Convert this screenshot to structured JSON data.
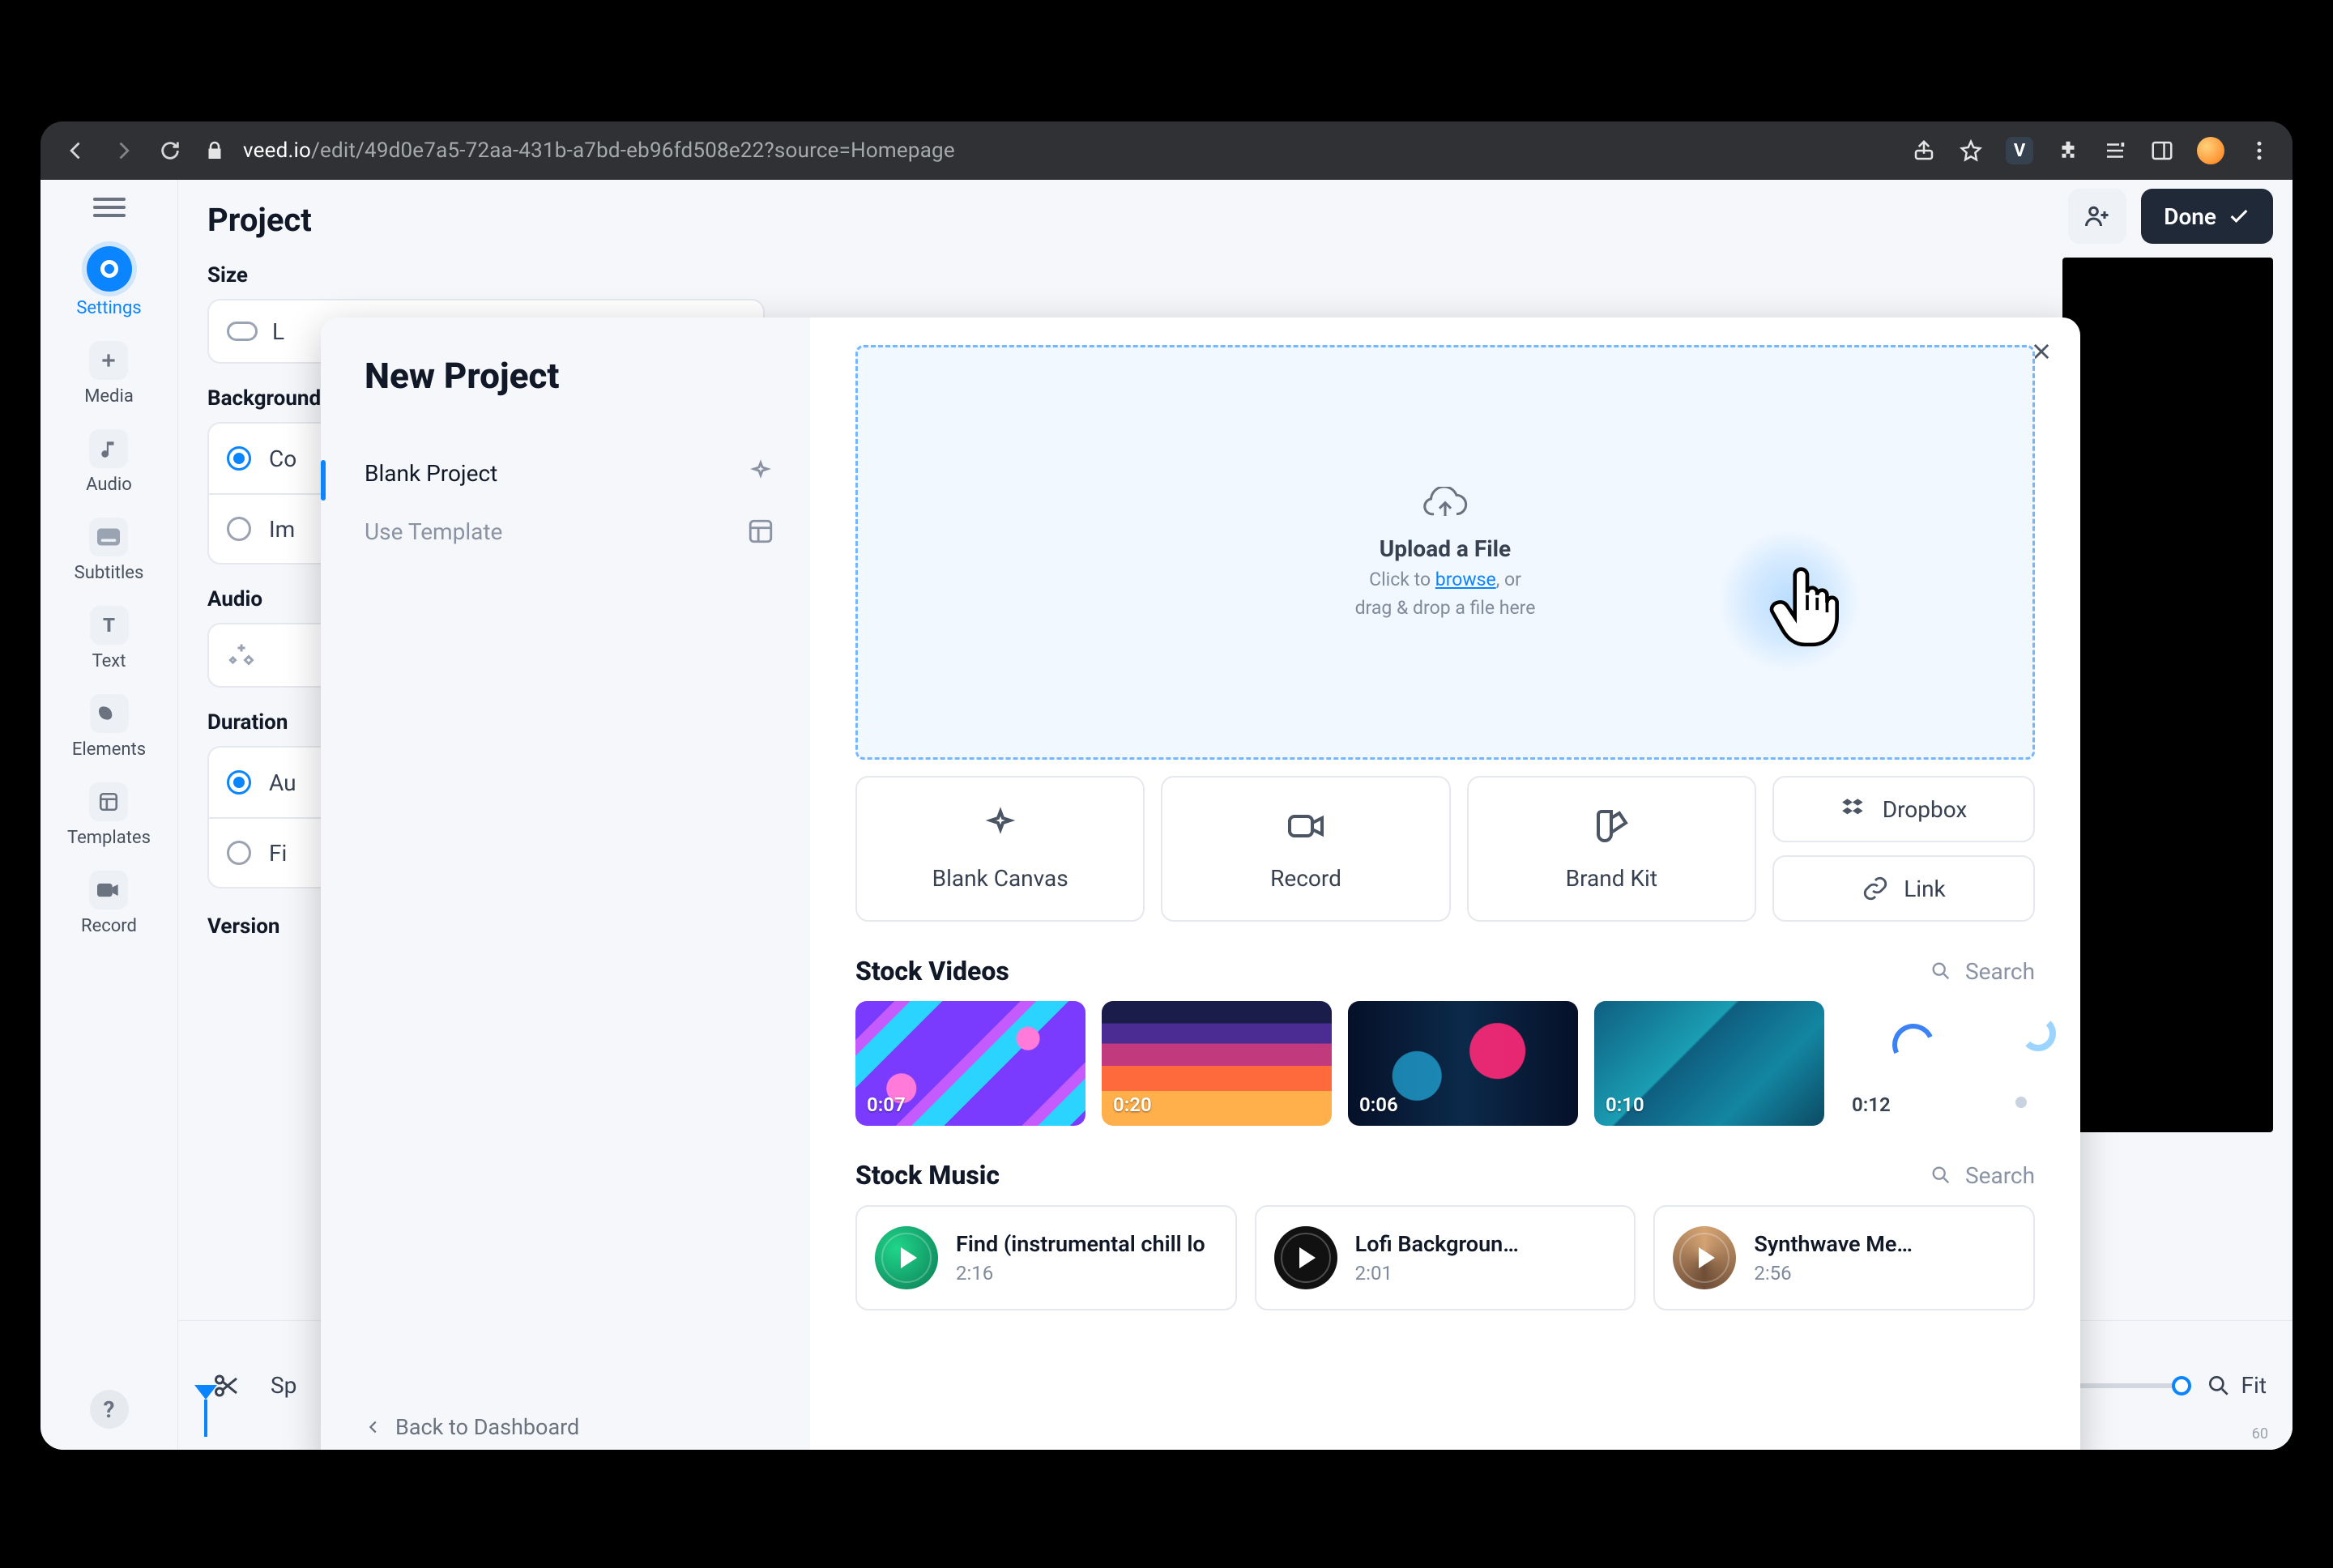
{
  "chrome": {
    "host": "veed.io",
    "path": "/edit/49d0e7a5-72aa-431b-a7bd-eb96fd508e22?source=Homepage",
    "ext_letter": "V"
  },
  "top": {
    "done": "Done"
  },
  "rail": {
    "settings": "Settings",
    "media": "Media",
    "audio": "Audio",
    "subtitles": "Subtitles",
    "text": "Text",
    "elements": "Elements",
    "templates": "Templates",
    "record": "Record",
    "help": "?"
  },
  "settings": {
    "title": "Project",
    "size_label": "Size",
    "size_value": "L",
    "background_label": "Background",
    "bg_color": "Co",
    "bg_image": "Im",
    "audio_label": "Audio",
    "duration_label": "Duration",
    "dur_auto": "Au",
    "dur_fixed": "Fi",
    "version_label": "Version",
    "split": "Sp"
  },
  "bottombar": {
    "fit": "Fit",
    "timeline_end": "60"
  },
  "modal": {
    "title": "New Project",
    "blank": "Blank Project",
    "template": "Use Template",
    "back": "Back to Dashboard",
    "upload_title": "Upload a File",
    "upload_sub_pre": "Click to ",
    "upload_browse": "browse",
    "upload_sub_post": ", or",
    "upload_sub2": "drag & drop a file here",
    "blank_canvas": "Blank Canvas",
    "record": "Record",
    "brand_kit": "Brand Kit",
    "dropbox": "Dropbox",
    "link": "Link",
    "stock_videos": "Stock Videos",
    "stock_music": "Stock Music",
    "search": "Search",
    "videos": [
      {
        "dur": "0:07"
      },
      {
        "dur": "0:20"
      },
      {
        "dur": "0:06"
      },
      {
        "dur": "0:10"
      },
      {
        "dur": "0:12"
      }
    ],
    "music": [
      {
        "title": "Find (instrumental chill lo",
        "dur": "2:16"
      },
      {
        "title": "Lofi Backgroun…",
        "dur": "2:01"
      },
      {
        "title": "Synthwave Me…",
        "dur": "2:56"
      }
    ]
  }
}
